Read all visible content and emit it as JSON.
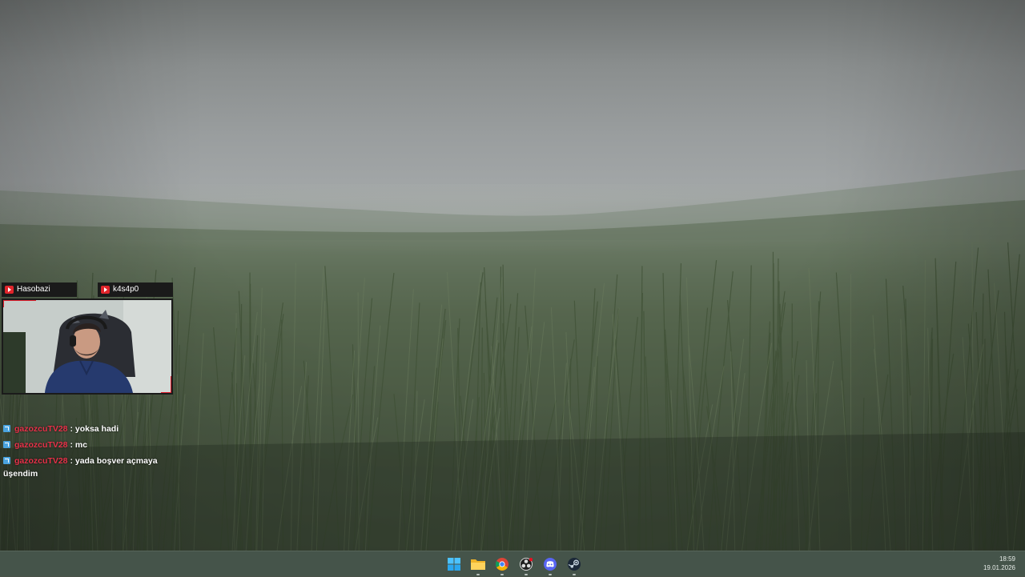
{
  "overlay": {
    "cam_labels": [
      "Hasobazi",
      "k4s4p0"
    ],
    "accent_color": "#e0202e"
  },
  "chat": {
    "messages": [
      {
        "user": "gazozcuTV28",
        "text": " : yoksa hadi"
      },
      {
        "user": "gazozcuTV28",
        "text": " : mc"
      },
      {
        "user": "gazozcuTV28",
        "text": " : yada boşver açmaya üşendim"
      }
    ],
    "user_color": "#e8324a"
  },
  "taskbar": {
    "pinned": [
      {
        "name": "start-icon"
      },
      {
        "name": "file-explorer-icon"
      },
      {
        "name": "chrome-icon"
      },
      {
        "name": "obs-icon"
      },
      {
        "name": "discord-icon"
      },
      {
        "name": "steam-icon"
      }
    ],
    "clock": {
      "time": "18:59",
      "date": "19.01.2026"
    }
  }
}
